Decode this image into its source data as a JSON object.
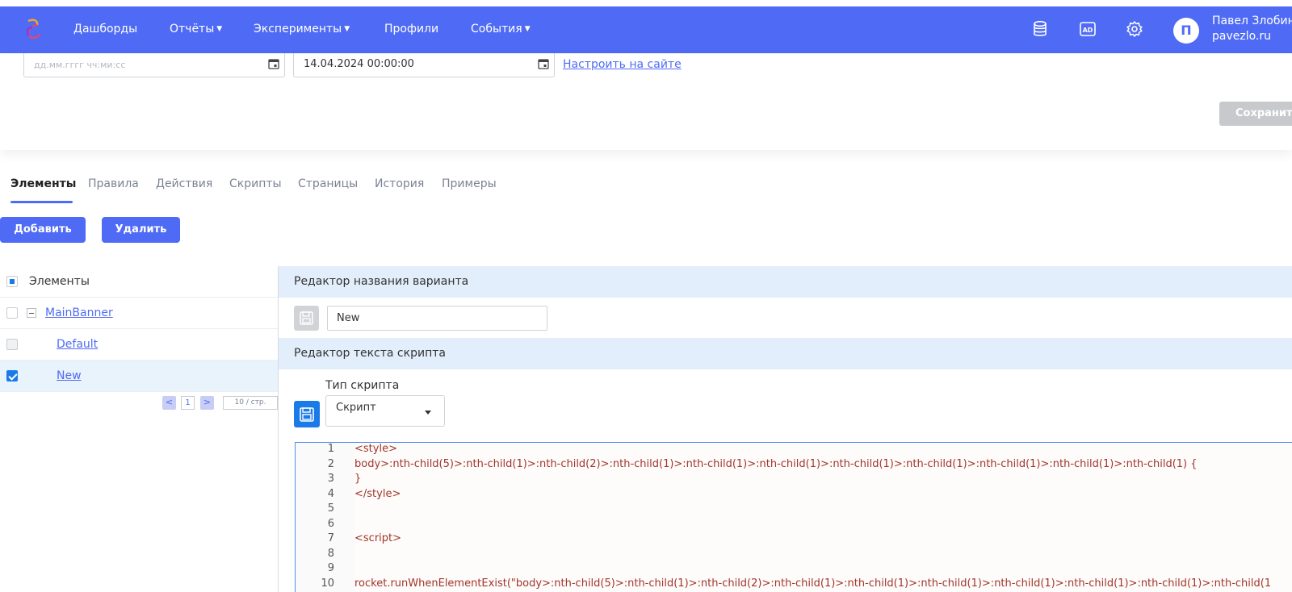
{
  "topbar": {
    "nav": [
      {
        "label": "Дашборды",
        "has_dropdown": false
      },
      {
        "label": "Отчёты",
        "has_dropdown": true
      },
      {
        "label": "Эксперименты",
        "has_dropdown": true
      },
      {
        "label": "Профили",
        "has_dropdown": false
      },
      {
        "label": "События",
        "has_dropdown": true
      }
    ],
    "icons": [
      "database-icon",
      "ad-icon",
      "gear-icon"
    ],
    "ad_icon_text": "AD",
    "user": {
      "initial": "П",
      "name": "Павел Злобин",
      "site": "pavezlo.ru"
    },
    "color": "#4f6bf5"
  },
  "form": {
    "date_from_placeholder": "дд.мм.гггг чч:ми:сс",
    "date_to_value": "14.04.2024 00:00:00",
    "setup_link": "Настроить на сайте",
    "save_label": "Сохранить"
  },
  "tabs": [
    {
      "label": "Элементы",
      "active": true
    },
    {
      "label": "Правила",
      "active": false
    },
    {
      "label": "Действия",
      "active": false
    },
    {
      "label": "Скрипты",
      "active": false
    },
    {
      "label": "Страницы",
      "active": false
    },
    {
      "label": "История",
      "active": false
    },
    {
      "label": "Примеры",
      "active": false
    }
  ],
  "actions": {
    "add_label": "Добавить",
    "delete_label": "Удалить"
  },
  "tree": {
    "header": "Элементы",
    "items": [
      {
        "label": "MainBanner",
        "state": "unchecked",
        "level": 0
      },
      {
        "label": "Default",
        "state": "disabled",
        "level": 1
      },
      {
        "label": "New",
        "state": "checked",
        "level": 1,
        "selected": true
      }
    ],
    "pager": {
      "prev": "<",
      "page": "1",
      "next": ">",
      "page_size": "10 / стр."
    }
  },
  "variant_editor": {
    "title": "Редактор названия варианта",
    "name_value": "New"
  },
  "script_editor": {
    "title": "Редактор текста скрипта",
    "type_label": "Тип скрипта",
    "type_value": "Скрипт",
    "lines": [
      {
        "n": "1",
        "code": "<style>"
      },
      {
        "n": "2",
        "code": "body>:nth-child(5)>:nth-child(1)>:nth-child(2)>:nth-child(1)>:nth-child(1)>:nth-child(1)>:nth-child(1)>:nth-child(1)>:nth-child(1)>:nth-child(1)>:nth-child(1) {"
      },
      {
        "n": "3",
        "code": "}"
      },
      {
        "n": "4",
        "code": "</style>"
      },
      {
        "n": "5",
        "code": ""
      },
      {
        "n": "6",
        "code": ""
      },
      {
        "n": "7",
        "code": "<script>"
      },
      {
        "n": "8",
        "code": ""
      },
      {
        "n": "9",
        "code": ""
      },
      {
        "n": "10",
        "code": "rocket.runWhenElementExist(\"body>:nth-child(5)>:nth-child(1)>:nth-child(2)>:nth-child(1)>:nth-child(1)>:nth-child(1)>:nth-child(1)>:nth-child(1)>:nth-child(1)>:nth-child(1"
      }
    ]
  }
}
